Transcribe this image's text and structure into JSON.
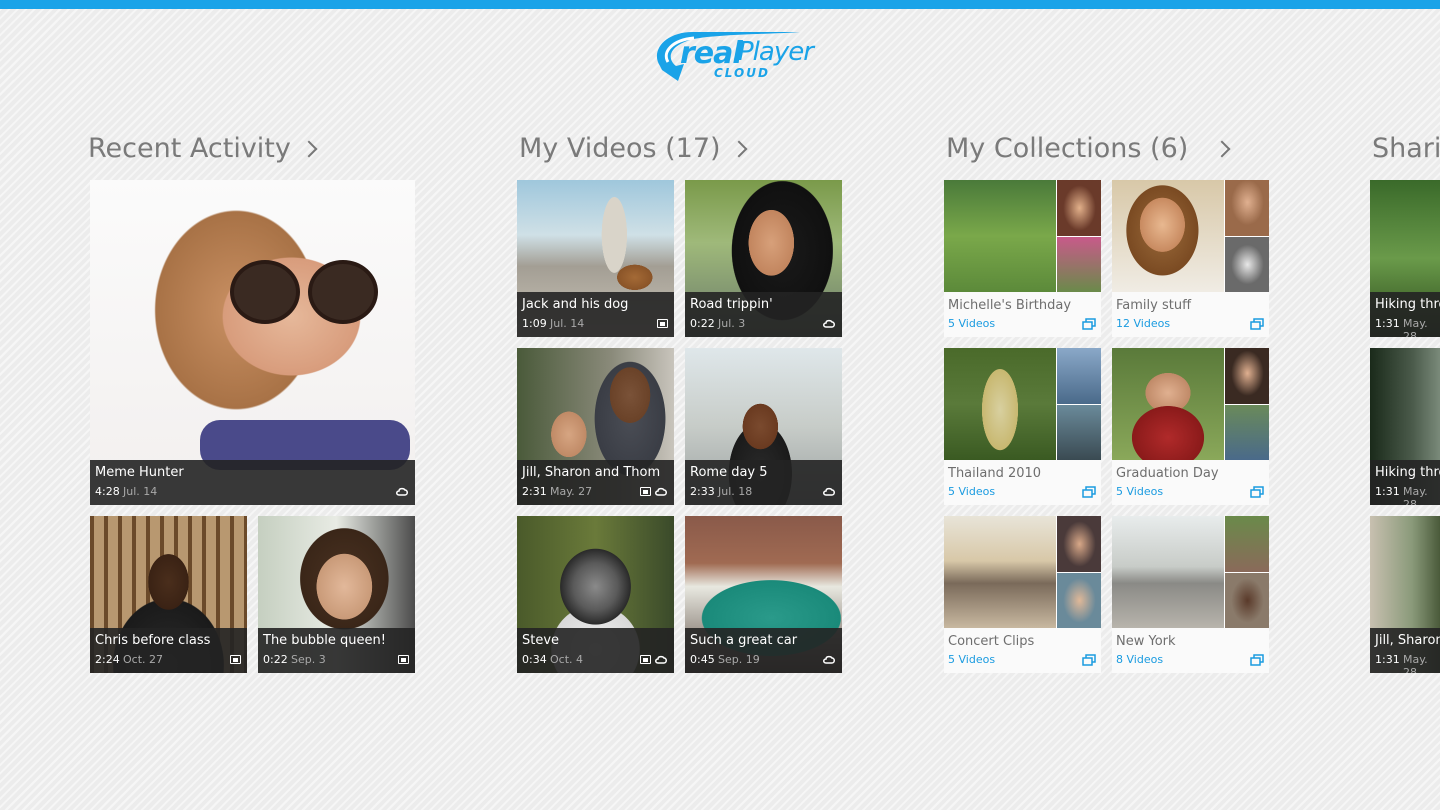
{
  "app": {
    "logo_word1": "real",
    "logo_word2": "Player",
    "logo_sub": "CLOUD",
    "accent_color": "#1aa3e8"
  },
  "sections": {
    "recent": "Recent Activity",
    "videos": "My Videos (17)",
    "collections": "My Collections (6)",
    "shared": "Shari"
  },
  "recent": [
    {
      "title": "Meme Hunter",
      "duration": "4:28",
      "date": "Jul. 14",
      "icons": [
        "cloud-sync-icon"
      ]
    },
    {
      "title": "Chris before class",
      "duration": "2:24",
      "date": "Oct. 27",
      "icons": [
        "device-icon"
      ]
    },
    {
      "title": "The bubble queen!",
      "duration": "0:22",
      "date": "Sep. 3",
      "icons": [
        "device-icon"
      ]
    }
  ],
  "videos": [
    {
      "title": "Jack and his dog",
      "duration": "1:09",
      "date": "Jul. 14",
      "icons": [
        "device-icon"
      ]
    },
    {
      "title": "Road trippin'",
      "duration": "0:22",
      "date": "Jul. 3",
      "icons": [
        "cloud-sync-icon"
      ]
    },
    {
      "title": "Jill, Sharon and Thom",
      "duration": "2:31",
      "date": "May. 27",
      "icons": [
        "device-icon",
        "cloud-sync-icon"
      ]
    },
    {
      "title": "Rome day 5",
      "duration": "2:33",
      "date": "Jul. 18",
      "icons": [
        "cloud-sync-icon"
      ]
    },
    {
      "title": "Steve",
      "duration": "0:34",
      "date": "Oct. 4",
      "icons": [
        "device-icon",
        "cloud-sync-icon"
      ]
    },
    {
      "title": "Such a great car",
      "duration": "0:45",
      "date": "Sep. 19",
      "icons": [
        "cloud-sync-icon"
      ]
    }
  ],
  "collections": [
    {
      "title": "Michelle's Birthday",
      "count": "5 Videos"
    },
    {
      "title": "Family stuff",
      "count": "12 Videos"
    },
    {
      "title": "Thailand 2010",
      "count": "5 Videos"
    },
    {
      "title": "Graduation Day",
      "count": "5 Videos"
    },
    {
      "title": "Concert Clips",
      "count": "5 Videos"
    },
    {
      "title": "New York",
      "count": "8 Videos"
    }
  ],
  "shared": [
    {
      "title": "Hiking thro",
      "duration": "1:31",
      "date": "May. 28"
    },
    {
      "title": "Hiking thro",
      "duration": "1:31",
      "date": "May. 28"
    },
    {
      "title": "Jill, Sharon",
      "duration": "1:31",
      "date": "May. 28"
    }
  ]
}
